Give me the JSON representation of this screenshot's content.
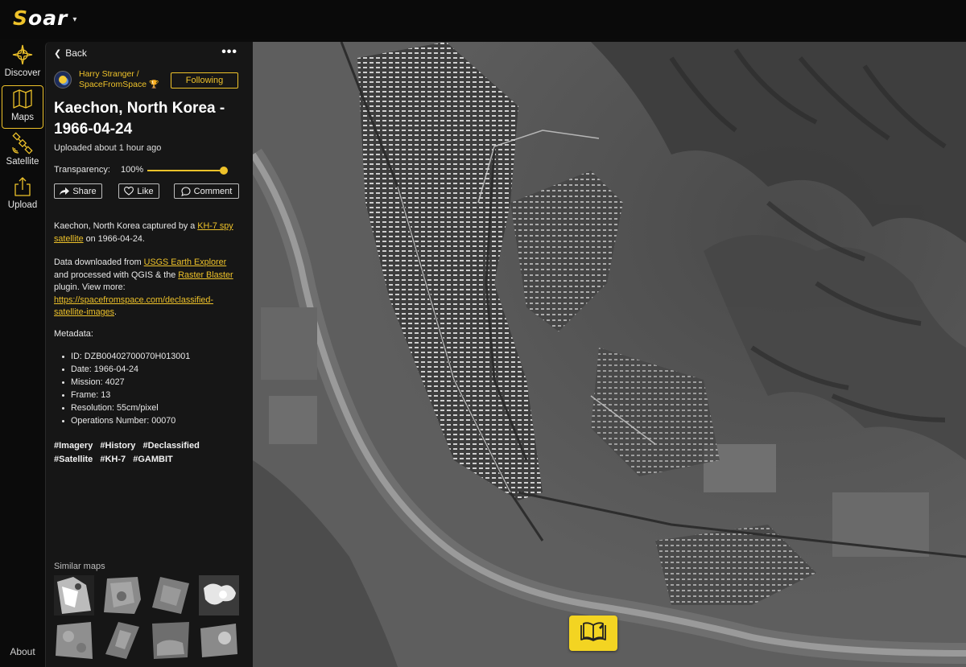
{
  "app": {
    "logo_text": "oar",
    "logo_letter": "S",
    "brand_color": "#eec22a"
  },
  "nav": {
    "items": [
      {
        "label": "Discover",
        "icon": "compass-icon",
        "active": false
      },
      {
        "label": "Maps",
        "icon": "map-icon",
        "active": true
      },
      {
        "label": "Satellite",
        "icon": "satellite-icon",
        "active": false
      },
      {
        "label": "Upload",
        "icon": "upload-icon",
        "active": false
      }
    ],
    "about_label": "About"
  },
  "panel": {
    "back_label": "Back",
    "more_label": "•••",
    "author": {
      "name_line1": "Harry Stranger /",
      "name_line2": "SpaceFromSpace",
      "badge": "🏆"
    },
    "follow_label": "Following",
    "title_line1": "Kaechon, North Korea -",
    "title_line2": "1966-04-24",
    "uploaded": "Uploaded about 1 hour ago",
    "transparency": {
      "label": "Transparency:",
      "value_text": "100%",
      "value": 1.0
    },
    "actions": {
      "share": "Share",
      "like": "Like",
      "comment": "Comment"
    },
    "description": {
      "p1_a": "Kaechon, North Korea captured by a ",
      "p1_link": "KH-7 spy satellite",
      "p1_b": " on 1966-04-24.",
      "p2_a": "Data downloaded from ",
      "p2_link1": "USGS Earth Explorer",
      "p2_b": " and processed with QGIS & the ",
      "p2_link2": "Raster Blaster",
      "p2_c": " plugin. View more: ",
      "p2_link3": "https://spacefromspace.com/declassified-satellite-images",
      "p2_d": "."
    },
    "metadata_title": "Metadata:",
    "metadata": [
      "ID: DZB00402700070H013001",
      "Date: 1966-04-24",
      "Mission: 4027",
      "Frame: 13",
      "Resolution: 55cm/pixel",
      "Operations Number: 00070"
    ],
    "tags": [
      "#Imagery",
      "#History",
      "#Declassified",
      "#Satellite",
      "#KH-7",
      "#GAMBIT"
    ],
    "similar_title": "Similar maps"
  }
}
